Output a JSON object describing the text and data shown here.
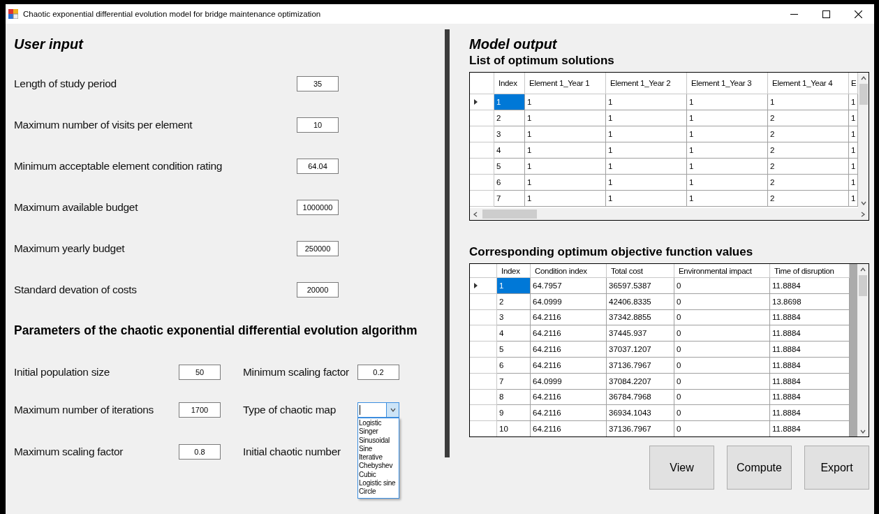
{
  "window": {
    "title": "Chaotic exponential differential evolution model for bridge maintenance optimization"
  },
  "user_input": {
    "title": "User input",
    "fields": [
      {
        "label": "Length of study period",
        "value": "35"
      },
      {
        "label": "Maximum number of visits per element",
        "value": "10"
      },
      {
        "label": "Minimum acceptable element condition rating",
        "value": "64.04"
      },
      {
        "label": "Maximum available budget",
        "value": "1000000"
      },
      {
        "label": "Maximum yearly budget",
        "value": "250000"
      },
      {
        "label": "Standard devation of costs",
        "value": "20000"
      }
    ]
  },
  "parameters": {
    "title": "Parameters of the chaotic exponential differential evolution algorithm",
    "columns": [
      {
        "fields": [
          {
            "kind": "text",
            "label": "Initial population size",
            "value": "50"
          },
          {
            "kind": "text",
            "label": "Maximum number of iterations",
            "value": "1700"
          },
          {
            "kind": "text",
            "label": "Maximum scaling factor",
            "value": "0.8"
          }
        ]
      },
      {
        "fields": [
          {
            "kind": "text",
            "label": "Minimum scaling factor",
            "value": "0.2"
          },
          {
            "kind": "dropdown",
            "label": "Type of chaotic map",
            "expanded": true,
            "options": [
              "Logistic",
              "Singer",
              "Sinusoidal",
              "Sine",
              "Iterative",
              "Chebyshev",
              "Cubic",
              "Logistic sine",
              "Circle"
            ]
          },
          {
            "kind": "label",
            "label": "Initial chaotic number"
          }
        ]
      }
    ]
  },
  "model_output": {
    "title": "Model output",
    "solutions": {
      "title": "List of optimum solutions",
      "columns": [
        "Index",
        "Element 1_Year 1",
        "Element 1_Year 2",
        "Element 1_Year 3",
        "Element 1_Year 4",
        "E"
      ],
      "rows": [
        {
          "selected": true,
          "cells": [
            "1",
            "1",
            "1",
            "1",
            "1",
            "1"
          ]
        },
        {
          "selected": false,
          "cells": [
            "2",
            "1",
            "1",
            "1",
            "2",
            "1"
          ]
        },
        {
          "selected": false,
          "cells": [
            "3",
            "1",
            "1",
            "1",
            "2",
            "1"
          ]
        },
        {
          "selected": false,
          "cells": [
            "4",
            "1",
            "1",
            "1",
            "2",
            "1"
          ]
        },
        {
          "selected": false,
          "cells": [
            "5",
            "1",
            "1",
            "1",
            "2",
            "1"
          ]
        },
        {
          "selected": false,
          "cells": [
            "6",
            "1",
            "1",
            "1",
            "2",
            "1"
          ]
        },
        {
          "selected": false,
          "cells": [
            "7",
            "1",
            "1",
            "1",
            "2",
            "1"
          ]
        }
      ]
    },
    "objectives": {
      "title": "Corresponding optimum objective function values",
      "columns": [
        "Index",
        "Condition index",
        "Total cost",
        "Environmental impact",
        "Time of disruption"
      ],
      "rows": [
        {
          "selected": true,
          "cells": [
            "1",
            "64.7957",
            "36597.5387",
            "0",
            "11.8884"
          ]
        },
        {
          "selected": false,
          "cells": [
            "2",
            "64.0999",
            "42406.8335",
            "0",
            "13.8698"
          ]
        },
        {
          "selected": false,
          "cells": [
            "3",
            "64.2116",
            "37342.8855",
            "0",
            "11.8884"
          ]
        },
        {
          "selected": false,
          "cells": [
            "4",
            "64.2116",
            "37445.937",
            "0",
            "11.8884"
          ]
        },
        {
          "selected": false,
          "cells": [
            "5",
            "64.2116",
            "37037.1207",
            "0",
            "11.8884"
          ]
        },
        {
          "selected": false,
          "cells": [
            "6",
            "64.2116",
            "37136.7967",
            "0",
            "11.8884"
          ]
        },
        {
          "selected": false,
          "cells": [
            "7",
            "64.0999",
            "37084.2207",
            "0",
            "11.8884"
          ]
        },
        {
          "selected": false,
          "cells": [
            "8",
            "64.2116",
            "36784.7968",
            "0",
            "11.8884"
          ]
        },
        {
          "selected": false,
          "cells": [
            "9",
            "64.2116",
            "36934.1043",
            "0",
            "11.8884"
          ]
        },
        {
          "selected": false,
          "cells": [
            "10",
            "64.2116",
            "37136.7967",
            "0",
            "11.8884"
          ]
        }
      ]
    }
  },
  "buttons": [
    "View",
    "Compute",
    "Export"
  ]
}
